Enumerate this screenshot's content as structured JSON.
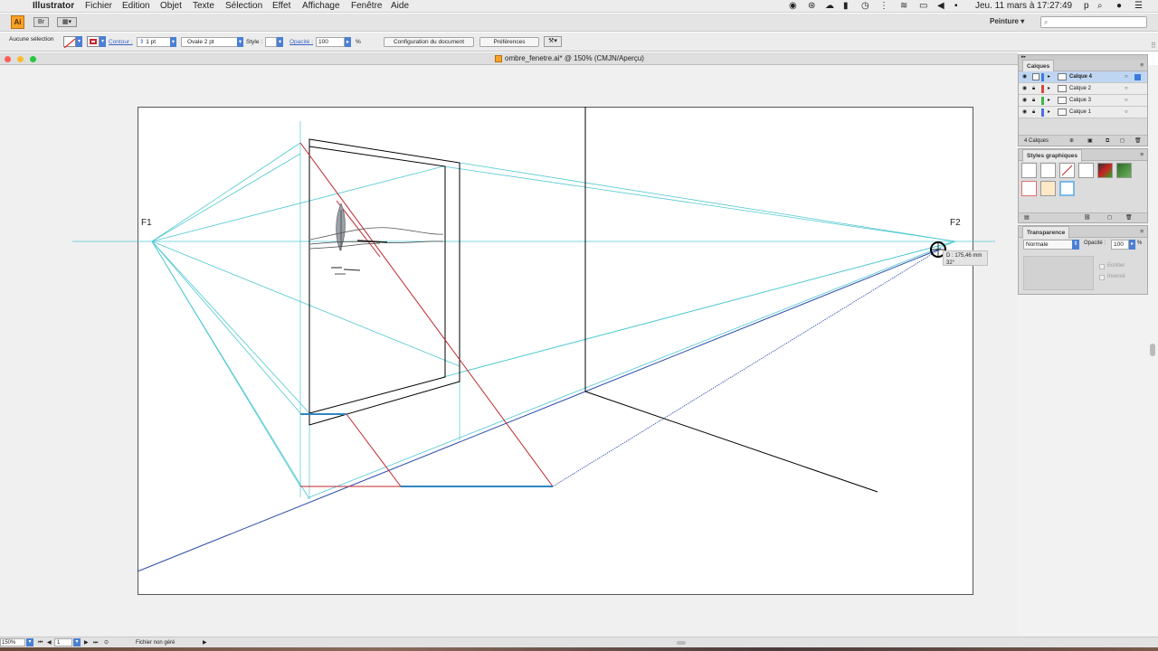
{
  "menubar": {
    "app_name": "Illustrator",
    "menus": [
      "Fichier",
      "Edition",
      "Objet",
      "Texte",
      "Sélection",
      "Effet",
      "Affichage",
      "Fenêtre",
      "Aide"
    ],
    "clock": "Jeu. 11 mars à 17:27:49",
    "user_initial": "p"
  },
  "appbar": {
    "logo": "Ai",
    "workspace": "Peinture ▾"
  },
  "control_bar": {
    "selection_status": "Aucune sélection",
    "stroke_label": "Contour :",
    "stroke_weight": "1 pt",
    "brush": "Ovale 2 pt",
    "style_label": "Style :",
    "opacity_label": "Opacité :",
    "opacity_value": "100",
    "percent": "%",
    "document_setup_button": "Configuration du document",
    "preferences_button": "Préférences"
  },
  "document_tab": {
    "title": "ombre_fenetre.ai* @ 150% (CMJN/Aperçu)"
  },
  "canvas": {
    "label_f1": "F1",
    "label_f2": "F2",
    "cursor_tooltip_distance": "D : 175,46 mm",
    "cursor_tooltip_angle": "32°"
  },
  "layers_panel": {
    "tab": "Calques",
    "layers": [
      {
        "name": "Calque 4",
        "color": "#3d7bdc",
        "selected": true
      },
      {
        "name": "Calque 2",
        "color": "#e0443e",
        "selected": false
      },
      {
        "name": "Calque 3",
        "color": "#3bb84a",
        "selected": false
      },
      {
        "name": "Calque 1",
        "color": "#4a6fe0",
        "selected": false
      }
    ],
    "count": "4 Calques"
  },
  "graphic_styles_panel": {
    "tab": "Styles graphiques"
  },
  "transparency_panel": {
    "tab": "Transparence",
    "blend_mode": "Normale",
    "opacity_label": "Opacité :",
    "opacity_value": "100",
    "percent": "%",
    "clip_label": "Ecrêter",
    "invert_label": "Inversé"
  },
  "statusbar": {
    "zoom": "150%",
    "artboard_number": "1",
    "status": "Fichier non géré"
  },
  "colors": {
    "construction_cyan": "#4fc8d0",
    "shadow_red": "#c0262e",
    "ground_blue": "#2a4aa8",
    "shadow_segment": "#2e86c1"
  }
}
